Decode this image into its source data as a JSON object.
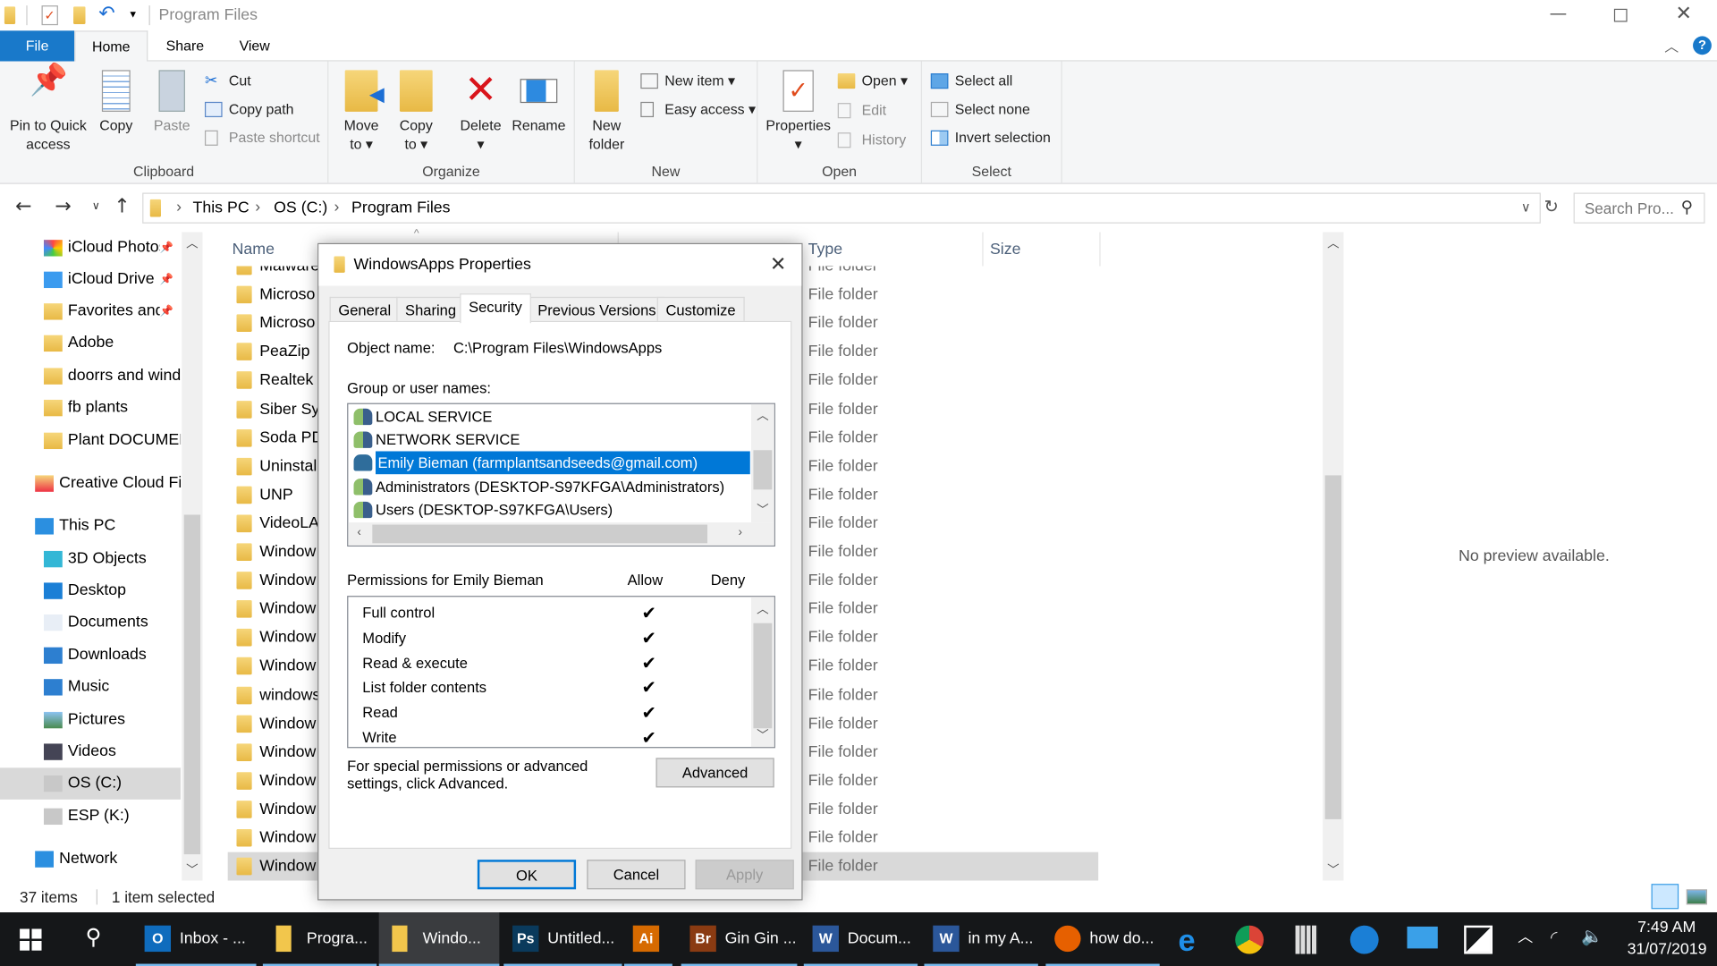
{
  "window": {
    "title": "Program Files"
  },
  "ribbon_tabs": [
    {
      "label": "File"
    },
    {
      "label": "Home"
    },
    {
      "label": "Share"
    },
    {
      "label": "View"
    }
  ],
  "ribbon": {
    "clipboard": {
      "label": "Clipboard",
      "pin": "Pin to Quick access",
      "copy": "Copy",
      "paste": "Paste",
      "cut": "Cut",
      "copy_path": "Copy path",
      "paste_shortcut": "Paste shortcut"
    },
    "organize": {
      "label": "Organize",
      "move_to": "Move to",
      "copy_to": "Copy to",
      "delete": "Delete",
      "rename": "Rename"
    },
    "new": {
      "label": "New",
      "new_folder": "New folder",
      "new_item": "New item",
      "easy_access": "Easy access"
    },
    "open": {
      "label": "Open",
      "properties": "Properties",
      "open": "Open",
      "edit": "Edit",
      "history": "History"
    },
    "select": {
      "label": "Select",
      "select_all": "Select all",
      "select_none": "Select none",
      "invert": "Invert selection"
    }
  },
  "address": {
    "crumbs": [
      "This PC",
      "OS (C:)",
      "Program Files"
    ],
    "search_placeholder": "Search Pro..."
  },
  "nav": [
    {
      "label": "iCloud Photos",
      "icon": "photos-icon",
      "pinned": true
    },
    {
      "label": "iCloud Drive",
      "icon": "cloud-icon",
      "pinned": true
    },
    {
      "label": "Favorites and",
      "icon": "folder-icon",
      "pinned": true
    },
    {
      "label": "Adobe",
      "icon": "folder-icon"
    },
    {
      "label": "doorrs and windows",
      "icon": "folder-icon"
    },
    {
      "label": "fb plants",
      "icon": "folder-icon"
    },
    {
      "label": "Plant DOCUMENTS",
      "icon": "folder-icon"
    },
    {
      "label": "Creative Cloud Files",
      "icon": "creative-cloud-icon"
    },
    {
      "label": "This PC",
      "icon": "computer-icon"
    },
    {
      "label": "3D Objects",
      "icon": "cube-icon"
    },
    {
      "label": "Desktop",
      "icon": "desktop-icon"
    },
    {
      "label": "Documents",
      "icon": "document-icon"
    },
    {
      "label": "Downloads",
      "icon": "download-icon"
    },
    {
      "label": "Music",
      "icon": "music-icon"
    },
    {
      "label": "Pictures",
      "icon": "pictures-icon"
    },
    {
      "label": "Videos",
      "icon": "videos-icon"
    },
    {
      "label": "OS (C:)",
      "icon": "drive-icon",
      "selected": true
    },
    {
      "label": "ESP (K:)",
      "icon": "drive-icon"
    },
    {
      "label": "Network",
      "icon": "network-icon"
    }
  ],
  "columns": {
    "name": "Name",
    "type": "Type",
    "size": "Size"
  },
  "files": [
    {
      "name": "Malware",
      "type": "File folder"
    },
    {
      "name": "Microso",
      "type": "File folder"
    },
    {
      "name": "Microso",
      "type": "File folder"
    },
    {
      "name": "PeaZip",
      "type": "File folder"
    },
    {
      "name": "Realtek",
      "type": "File folder"
    },
    {
      "name": "Siber Sy",
      "type": "File folder"
    },
    {
      "name": "Soda PD",
      "type": "File folder"
    },
    {
      "name": "Uninstall",
      "type": "File folder"
    },
    {
      "name": "UNP",
      "type": "File folder"
    },
    {
      "name": "VideoLA",
      "type": "File folder"
    },
    {
      "name": "Window",
      "type": "File folder"
    },
    {
      "name": "Window",
      "type": "File folder"
    },
    {
      "name": "Window",
      "type": "File folder"
    },
    {
      "name": "Window",
      "type": "File folder"
    },
    {
      "name": "Window",
      "type": "File folder"
    },
    {
      "name": "windows",
      "type": "File folder"
    },
    {
      "name": "Window",
      "type": "File folder"
    },
    {
      "name": "Window",
      "type": "File folder"
    },
    {
      "name": "Window",
      "type": "File folder"
    },
    {
      "name": "Window",
      "type": "File folder"
    },
    {
      "name": "Window",
      "type": "File folder"
    },
    {
      "name": "Window",
      "type": "File folder",
      "selected": true
    }
  ],
  "preview": {
    "text": "No preview available."
  },
  "status": {
    "count": "37 items",
    "selected": "1 item selected"
  },
  "dialog": {
    "title": "WindowsApps Properties",
    "tabs": [
      "General",
      "Sharing",
      "Security",
      "Previous Versions",
      "Customize"
    ],
    "object_label": "Object name:",
    "object_value": "C:\\Program Files\\WindowsApps",
    "group_label": "Group or user names:",
    "users": [
      {
        "name": "LOCAL SERVICE"
      },
      {
        "name": "NETWORK SERVICE"
      },
      {
        "name": "Emily Bieman (farmplantsandseeds@gmail.com)",
        "selected": true
      },
      {
        "name": "Administrators (DESKTOP-S97KFGA\\Administrators)"
      },
      {
        "name": "Users (DESKTOP-S97KFGA\\Users)"
      }
    ],
    "perm_label": "Permissions for Emily Bieman",
    "allow": "Allow",
    "deny": "Deny",
    "permissions": [
      {
        "name": "Full control",
        "allow": true,
        "deny": false
      },
      {
        "name": "Modify",
        "allow": true,
        "deny": false
      },
      {
        "name": "Read & execute",
        "allow": true,
        "deny": false
      },
      {
        "name": "List folder contents",
        "allow": true,
        "deny": false
      },
      {
        "name": "Read",
        "allow": true,
        "deny": false
      },
      {
        "name": "Write",
        "allow": true,
        "deny": false
      }
    ],
    "advanced_text": "For special permissions or advanced settings, click Advanced.",
    "advanced": "Advanced",
    "ok": "OK",
    "cancel": "Cancel",
    "apply": "Apply"
  },
  "taskbar": {
    "apps": [
      {
        "label": "Inbox - ...",
        "icon": "outlook-icon",
        "badge": "O",
        "color": "#0f6cbd"
      },
      {
        "label": "Progra...",
        "icon": "folder-icon",
        "badge": "",
        "color": "#f2c64c"
      },
      {
        "label": "Windo...",
        "icon": "folder-icon",
        "badge": "",
        "color": "#f2c64c",
        "active": true
      },
      {
        "label": "Untitled...",
        "icon": "photoshop-icon",
        "badge": "Ps",
        "color": "#0a3a5c"
      },
      {
        "label": "",
        "icon": "illustrator-icon",
        "badge": "Ai",
        "color": "#d66a00"
      },
      {
        "label": "Gin Gin ...",
        "icon": "bridge-icon",
        "badge": "Br",
        "color": "#8a3b12"
      },
      {
        "label": "Docum...",
        "icon": "word-icon",
        "badge": "W",
        "color": "#2b579a"
      },
      {
        "label": "in my A...",
        "icon": "word-icon",
        "badge": "W",
        "color": "#2b579a"
      },
      {
        "label": "how do...",
        "icon": "firefox-icon",
        "badge": "",
        "color": "#e66000"
      }
    ],
    "time": "7:49 AM",
    "date": "31/07/2019"
  },
  "colors": {
    "accent": "#0078d7",
    "file_tab": "#1979ca",
    "taskbar": "#151719"
  }
}
